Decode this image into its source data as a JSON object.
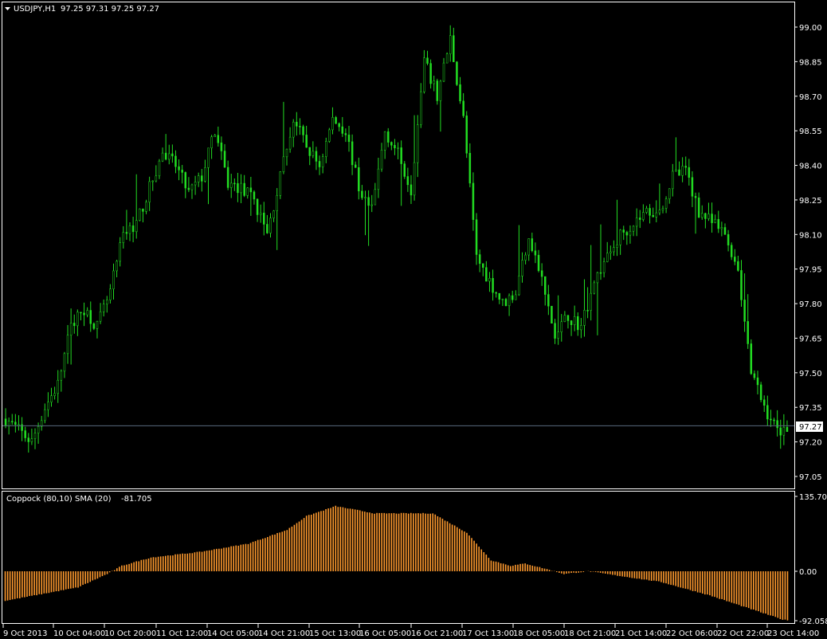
{
  "colors": {
    "background": "#000000",
    "frame": "#ffffff",
    "candle": "#22dd22",
    "indicator_bar": "#ff9a2e",
    "bid_line": "#5a6a7e",
    "text": "#ffffff"
  },
  "chart": {
    "header_icon": "triangle-down-icon",
    "symbol": "USDJPY,H1",
    "ohlc": "97.25 97.31 97.25 97.27",
    "current_price_label": "97.27",
    "price_axis_labels": [
      "99.00",
      "98.85",
      "98.70",
      "98.55",
      "98.40",
      "98.25",
      "98.10",
      "97.95",
      "97.80",
      "97.65",
      "97.50",
      "97.35",
      "97.20",
      "97.05"
    ],
    "time_axis_labels": [
      "9 Oct 2013",
      "10 Oct 04:00",
      "10 Oct 20:00",
      "11 Oct 12:00",
      "14 Oct 05:00",
      "14 Oct 21:00",
      "15 Oct 13:00",
      "16 Oct 05:00",
      "16 Oct 21:00",
      "17 Oct 13:00",
      "18 Oct 05:00",
      "18 Oct 21:00",
      "21 Oct 14:00",
      "22 Oct 06:00",
      "22 Oct 22:00",
      "23 Oct 14:00"
    ]
  },
  "indicator": {
    "label": "Coppock (80,10) SMA (20)",
    "value": "-81.705",
    "axis_labels": [
      "135.703",
      "0.00",
      "-92.058"
    ]
  },
  "chart_data": [
    {
      "type": "candlestick",
      "title": "USDJPY,H1",
      "ylim": [
        97.0,
        99.03
      ],
      "y_ticks": [
        99.0,
        98.85,
        98.7,
        98.55,
        98.4,
        98.25,
        98.1,
        97.95,
        97.8,
        97.65,
        97.5,
        97.35,
        97.2,
        97.05
      ],
      "x_tick_labels": [
        "9 Oct 2013",
        "10 Oct 04:00",
        "10 Oct 20:00",
        "11 Oct 12:00",
        "14 Oct 05:00",
        "14 Oct 21:00",
        "15 Oct 13:00",
        "16 Oct 05:00",
        "16 Oct 21:00",
        "17 Oct 13:00",
        "18 Oct 05:00",
        "18 Oct 21:00",
        "21 Oct 14:00",
        "22 Oct 06:00",
        "22 Oct 22:00",
        "23 Oct 14:00"
      ],
      "current_price": 97.27,
      "close_path": [
        [
          0,
          97.3
        ],
        [
          4,
          97.25
        ],
        [
          8,
          97.2
        ],
        [
          12,
          97.35
        ],
        [
          16,
          97.45
        ],
        [
          20,
          97.7
        ],
        [
          24,
          97.78
        ],
        [
          28,
          97.7
        ],
        [
          32,
          97.85
        ],
        [
          36,
          98.1
        ],
        [
          40,
          98.15
        ],
        [
          44,
          98.3
        ],
        [
          48,
          98.45
        ],
        [
          52,
          98.4
        ],
        [
          56,
          98.28
        ],
        [
          60,
          98.35
        ],
        [
          64,
          98.55
        ],
        [
          68,
          98.32
        ],
        [
          72,
          98.3
        ],
        [
          76,
          98.25
        ],
        [
          80,
          98.1
        ],
        [
          84,
          98.35
        ],
        [
          88,
          98.6
        ],
        [
          92,
          98.48
        ],
        [
          96,
          98.4
        ],
        [
          100,
          98.6
        ],
        [
          104,
          98.55
        ],
        [
          108,
          98.3
        ],
        [
          112,
          98.2
        ],
        [
          116,
          98.55
        ],
        [
          120,
          98.45
        ],
        [
          124,
          98.3
        ],
        [
          128,
          98.85
        ],
        [
          132,
          98.7
        ],
        [
          136,
          98.95
        ],
        [
          140,
          98.6
        ],
        [
          144,
          98.0
        ],
        [
          148,
          97.9
        ],
        [
          152,
          97.8
        ],
        [
          156,
          97.85
        ],
        [
          160,
          98.1
        ],
        [
          164,
          97.9
        ],
        [
          168,
          97.65
        ],
        [
          172,
          97.75
        ],
        [
          176,
          97.7
        ],
        [
          180,
          97.9
        ],
        [
          184,
          98.0
        ],
        [
          188,
          98.1
        ],
        [
          192,
          98.15
        ],
        [
          196,
          98.2
        ],
        [
          200,
          98.2
        ],
        [
          204,
          98.35
        ],
        [
          208,
          98.38
        ],
        [
          212,
          98.2
        ],
        [
          216,
          98.15
        ],
        [
          220,
          98.1
        ],
        [
          224,
          97.95
        ],
        [
          228,
          97.5
        ],
        [
          232,
          97.35
        ],
        [
          236,
          97.25
        ],
        [
          240,
          97.27
        ]
      ],
      "approx_candles": 240
    },
    {
      "type": "bar",
      "title": "Coppock (80,10) SMA (20)",
      "ylim": [
        -92.058,
        135.703
      ],
      "zero_line": 0,
      "last_value": -81.705,
      "value_path": [
        [
          0,
          -55
        ],
        [
          30,
          -30
        ],
        [
          42,
          -5
        ],
        [
          48,
          10
        ],
        [
          60,
          25
        ],
        [
          80,
          35
        ],
        [
          100,
          50
        ],
        [
          116,
          75
        ],
        [
          124,
          100
        ],
        [
          136,
          118
        ],
        [
          152,
          105
        ],
        [
          176,
          105
        ],
        [
          190,
          70
        ],
        [
          200,
          20
        ],
        [
          208,
          10
        ],
        [
          214,
          14
        ],
        [
          222,
          5
        ],
        [
          230,
          -5
        ],
        [
          240,
          0
        ],
        [
          270,
          -20
        ],
        [
          290,
          -45
        ],
        [
          310,
          -75
        ],
        [
          320,
          -90
        ],
        [
          323,
          -92
        ]
      ],
      "bar_count": 323
    }
  ]
}
